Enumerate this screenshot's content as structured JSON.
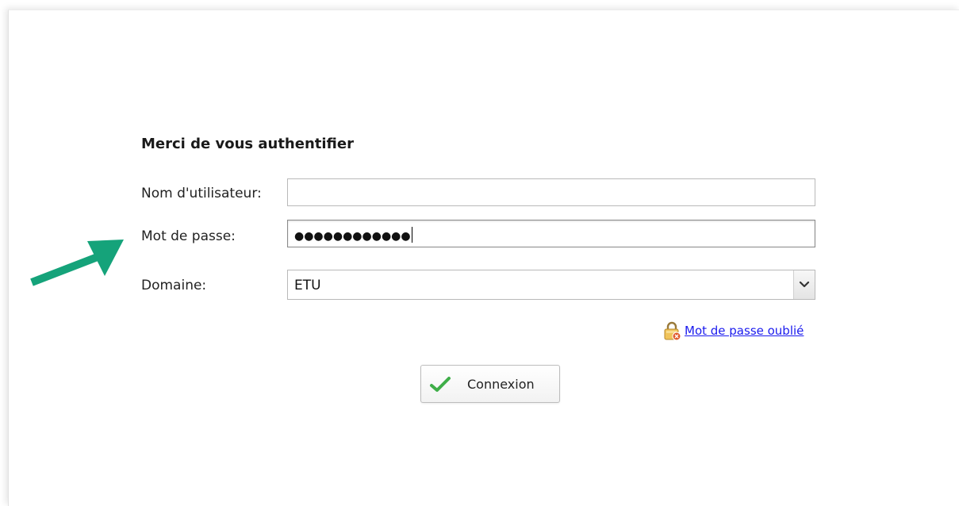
{
  "form": {
    "title": "Merci de vous authentifier",
    "username_label": "Nom d'utilisateur:",
    "username_value": "",
    "password_label": "Mot de passe:",
    "password_mask": "●●●●●●●●●●●●",
    "domain_label": "Domaine:",
    "domain_value": "ETU",
    "forgot_password": "Mot de passe oublié",
    "submit_label": "Connexion"
  },
  "icons": {
    "lock": "lock-icon",
    "check": "checkmark-icon",
    "dropdown": "chevron-down-icon",
    "annotation": "arrow-icon"
  },
  "colors": {
    "link": "#1a1aee",
    "check": "#3fae49",
    "annotation_arrow": "#15a37a"
  }
}
